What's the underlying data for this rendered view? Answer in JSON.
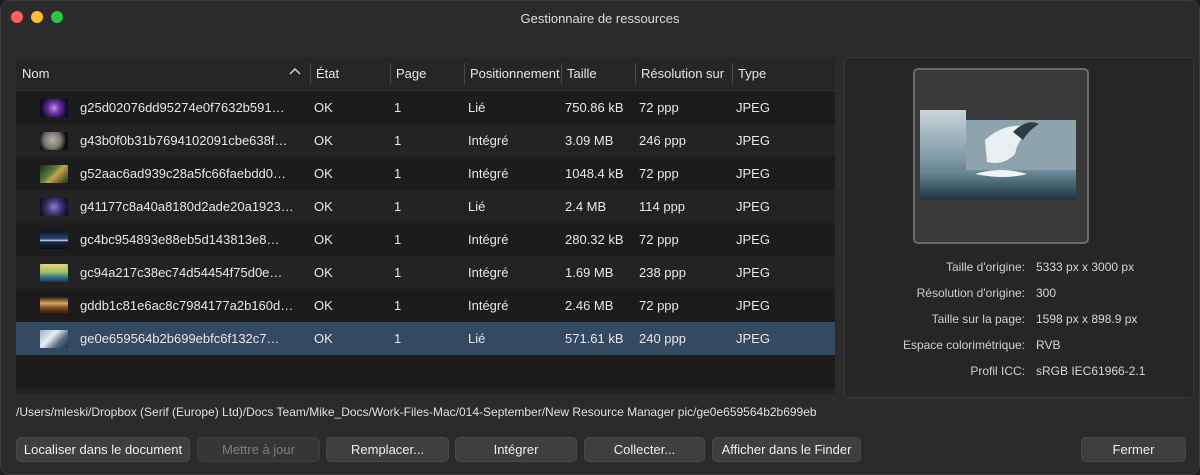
{
  "window": {
    "title": "Gestionnaire de ressources"
  },
  "table": {
    "columns": {
      "name": "Nom",
      "state": "État",
      "page": "Page",
      "positioning": "Positionnement",
      "size": "Taille",
      "resolution": "Résolution sur",
      "type": "Type"
    },
    "sort_icon": "chevron-up-icon",
    "rows": [
      {
        "name": "g25d02076dd95274e0f7632b591…",
        "state": "OK",
        "page": "1",
        "positioning": "Lié",
        "size": "750.86 kB",
        "resolution": "72 ppp",
        "type": "JPEG"
      },
      {
        "name": "g43b0f0b31b7694102091cbe638f…",
        "state": "OK",
        "page": "1",
        "positioning": "Intégré",
        "size": "3.09 MB",
        "resolution": "246 ppp",
        "type": "JPEG"
      },
      {
        "name": "g52aac6ad939c28a5fc66faebdd0…",
        "state": "OK",
        "page": "1",
        "positioning": "Intégré",
        "size": "1048.4 kB",
        "resolution": "72 ppp",
        "type": "JPEG"
      },
      {
        "name": "g41177c8a40a8180d2ade20a1923…",
        "state": "OK",
        "page": "1",
        "positioning": "Lié",
        "size": "2.4 MB",
        "resolution": "114 ppp",
        "type": "JPEG"
      },
      {
        "name": "gc4bc954893e88eb5d143813e8…",
        "state": "OK",
        "page": "1",
        "positioning": "Intégré",
        "size": "280.32 kB",
        "resolution": "72 ppp",
        "type": "JPEG"
      },
      {
        "name": "gc94a217c38ec74d54454f75d0e…",
        "state": "OK",
        "page": "1",
        "positioning": "Intégré",
        "size": "1.69 MB",
        "resolution": "238 ppp",
        "type": "JPEG"
      },
      {
        "name": "gddb1c81e6ac8c7984177a2b160d…",
        "state": "OK",
        "page": "1",
        "positioning": "Intégré",
        "size": "2.46 MB",
        "resolution": "72 ppp",
        "type": "JPEG"
      },
      {
        "name": "ge0e659564b2b699ebfc6f132c7…",
        "state": "OK",
        "page": "1",
        "positioning": "Lié",
        "size": "571.61 kB",
        "resolution": "240 ppp",
        "type": "JPEG"
      }
    ]
  },
  "details": {
    "original_size_label": "Taille d'origine:",
    "original_size_value": "5333 px x 3000 px",
    "original_res_label": "Résolution d'origine:",
    "original_res_value": "300",
    "page_size_label": "Taille sur la page:",
    "page_size_value": "1598 px x 898.9 px",
    "colorspace_label": "Espace colorimétrique:",
    "colorspace_value": "RVB",
    "icc_label": "Profil ICC:",
    "icc_value": "sRGB IEC61966-2.1"
  },
  "path": "/Users/mleski/Dropbox (Serif (Europe) Ltd)/Docs Team/Mike_Docs/Work-Files-Mac/014-September/New Resource Manager pic/ge0e659564b2b699eb",
  "buttons": {
    "locate": "Localiser dans le document",
    "update": "Mettre à jour",
    "replace": "Remplacer...",
    "embed": "Intégrer",
    "collect": "Collecter...",
    "finder": "Afficher dans le Finder",
    "close": "Fermer"
  }
}
